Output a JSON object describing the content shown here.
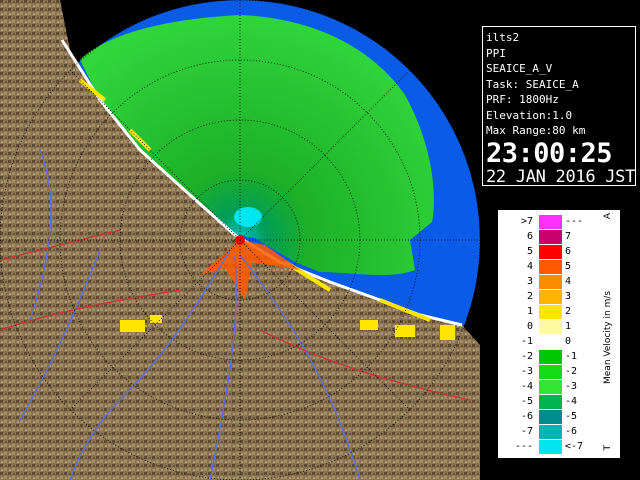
{
  "info": {
    "site": "ilts2",
    "product": "PPI",
    "scan_name": "SEAICE_A_V",
    "task": "Task: SEAICE_A",
    "prf": "PRF: 1800Hz",
    "elevation": "Elevation:1.0",
    "max_range": "Max Range:80 km",
    "time": "23:00:25",
    "date": "22 JAN 2016 JST"
  },
  "legend": {
    "title": "Mean Velocity in m/s",
    "corner_top": "A",
    "corner_bottom": "T",
    "rows": [
      {
        "left": ">7",
        "right": "---",
        "color": "#ff30ff"
      },
      {
        "left": "6",
        "right": "7",
        "color": "#c8006e"
      },
      {
        "left": "5",
        "right": "6",
        "color": "#ff0000"
      },
      {
        "left": "4",
        "right": "5",
        "color": "#ff5a00"
      },
      {
        "left": "3",
        "right": "4",
        "color": "#ff8c00"
      },
      {
        "left": "2",
        "right": "3",
        "color": "#ffb400"
      },
      {
        "left": "1",
        "right": "2",
        "color": "#ffe600"
      },
      {
        "left": "0",
        "right": "1",
        "color": "#fffaa0"
      },
      {
        "left": "-1",
        "right": "0",
        "color": "#ffffff"
      },
      {
        "left": "-2",
        "right": "-1",
        "color": "#00c800"
      },
      {
        "left": "-3",
        "right": "-2",
        "color": "#14dc14"
      },
      {
        "left": "-4",
        "right": "-3",
        "color": "#32e632"
      },
      {
        "left": "-5",
        "right": "-4",
        "color": "#00b450"
      },
      {
        "left": "-6",
        "right": "-5",
        "color": "#008c8c"
      },
      {
        "left": "-7",
        "right": "-6",
        "color": "#00b4b4"
      },
      {
        "left": "---",
        "right": "<-7",
        "color": "#00e6f0"
      }
    ]
  },
  "colors": {
    "sea_blue": "#0a5ce8",
    "echo_green": "#1ec81e",
    "land_brown": "#8a7350",
    "coast_line": "#ffffff"
  }
}
